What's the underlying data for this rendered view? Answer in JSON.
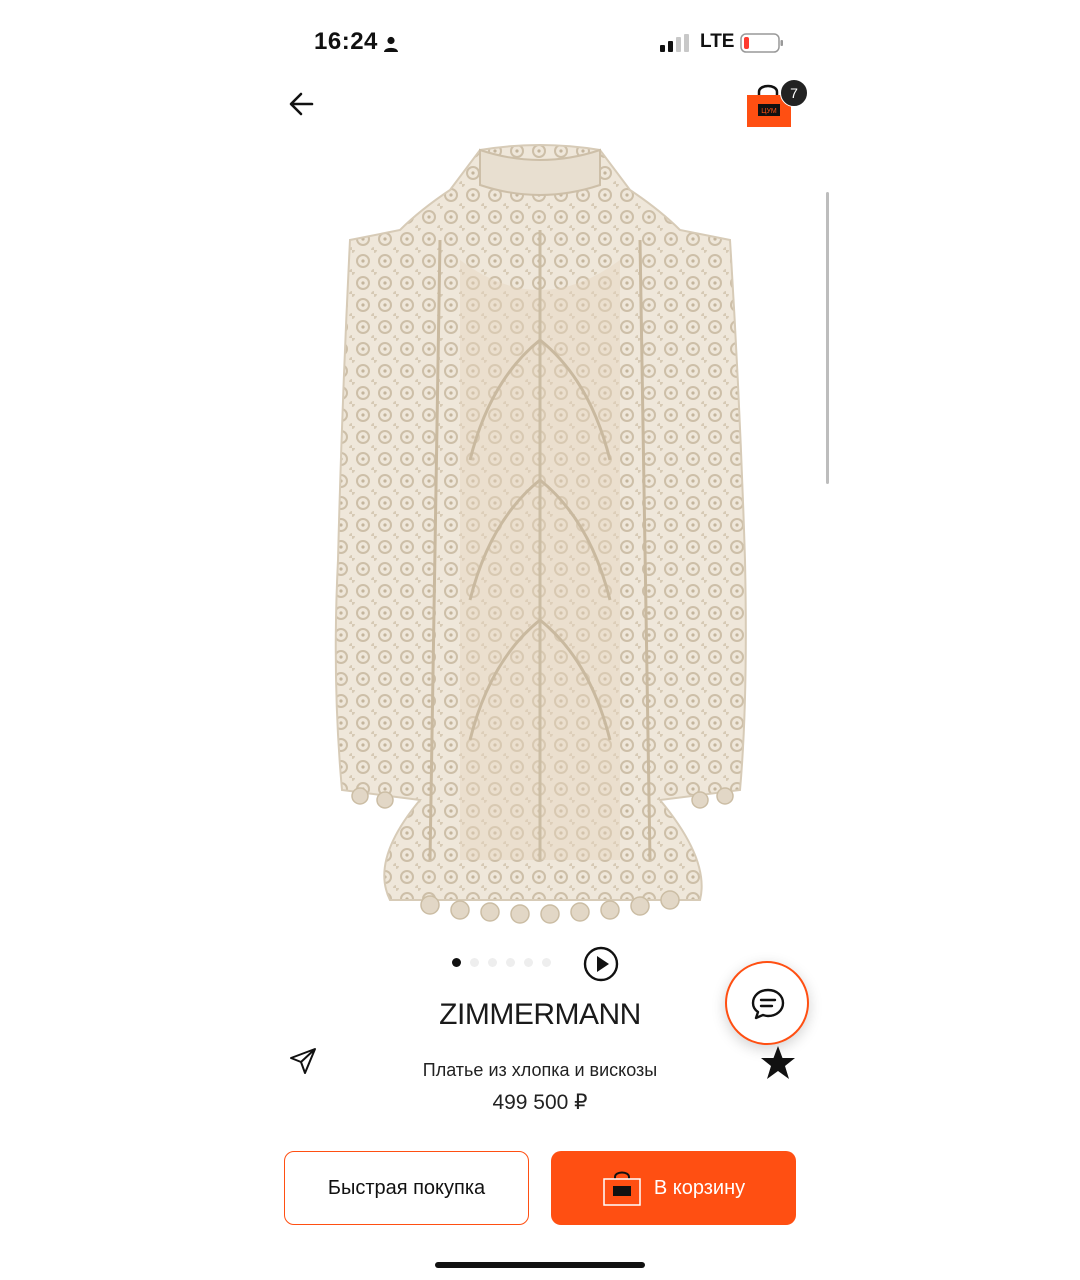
{
  "status_bar": {
    "time": "16:24",
    "network": "LTE"
  },
  "header": {
    "cart_count": "7",
    "cart_logo_text": "ЦУМ"
  },
  "colors": {
    "accent": "#ff4f12",
    "dress": "#e9e0d2"
  },
  "icons": {
    "back": "arrow-left-icon",
    "cart": "shopping-bag-icon",
    "play": "play-icon",
    "chat": "chat-bubble-icon",
    "share": "paper-plane-icon",
    "favorite": "star-icon"
  },
  "gallery": {
    "dots_total": 6,
    "active_index": 0
  },
  "product": {
    "brand": "ZIMMERMANN",
    "name": "Платье из хлопка и вискозы",
    "price": "499 500 ₽"
  },
  "actions": {
    "quick_buy": "Быстрая покупка",
    "add_to_cart": "В корзину"
  }
}
